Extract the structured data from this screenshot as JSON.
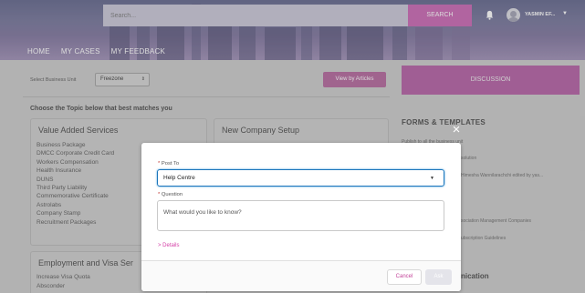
{
  "header": {
    "search": {
      "placeholder": "Search...",
      "button": "SEARCH"
    },
    "user": {
      "name": "YASMIN EF...",
      "chevron": "▼"
    },
    "nav": [
      "HOME",
      "MY CASES",
      "MY FEEDBACK"
    ]
  },
  "toolbar": {
    "business_unit_label": "Select Business Unit",
    "business_unit_value": "Freezone",
    "view_articles": "View by Articles",
    "discussion": "DISCUSSION"
  },
  "topics": {
    "heading": "Choose the Topic below that best matches you",
    "value_added": {
      "title": "Value Added Services",
      "items": [
        "Business Package",
        "DMCC Corporate Credit Card",
        "Workers Compensation",
        "Health Insurance",
        "DUNS",
        "Third Party Liability",
        "Commemorative Certificate",
        "Astrolabs",
        "Company Stamp",
        "Recruitment Packages"
      ]
    },
    "new_company": {
      "title": "New Company Setup"
    },
    "employment": {
      "title": "Employment and Visa Ser",
      "items": [
        "Increase Visa Quota",
        "Absconder"
      ]
    }
  },
  "sidebar": {
    "forms_title": "FORMS & TEMPLATES",
    "snippets": [
      "Publish to all the business unit",
      "solution",
      "Himesha Wannilarachchi edited by yas...",
      "sociation Management Companies",
      "ubscription Guidelines",
      "nication"
    ]
  },
  "modal": {
    "close": "×",
    "post_to_label": "Post To",
    "post_to_value": "Help Centre",
    "question_label": "Question",
    "question_placeholder": "What would you like to know?",
    "details_link": "> Details",
    "cancel": "Cancel",
    "ask": "Ask"
  },
  "colors": {
    "accent": "#c760b0",
    "focus": "#1b75bb",
    "link": "#d43fa6"
  },
  "icons": [
    "bell-icon",
    "avatar",
    "close-icon",
    "chevron-down-icon"
  ]
}
